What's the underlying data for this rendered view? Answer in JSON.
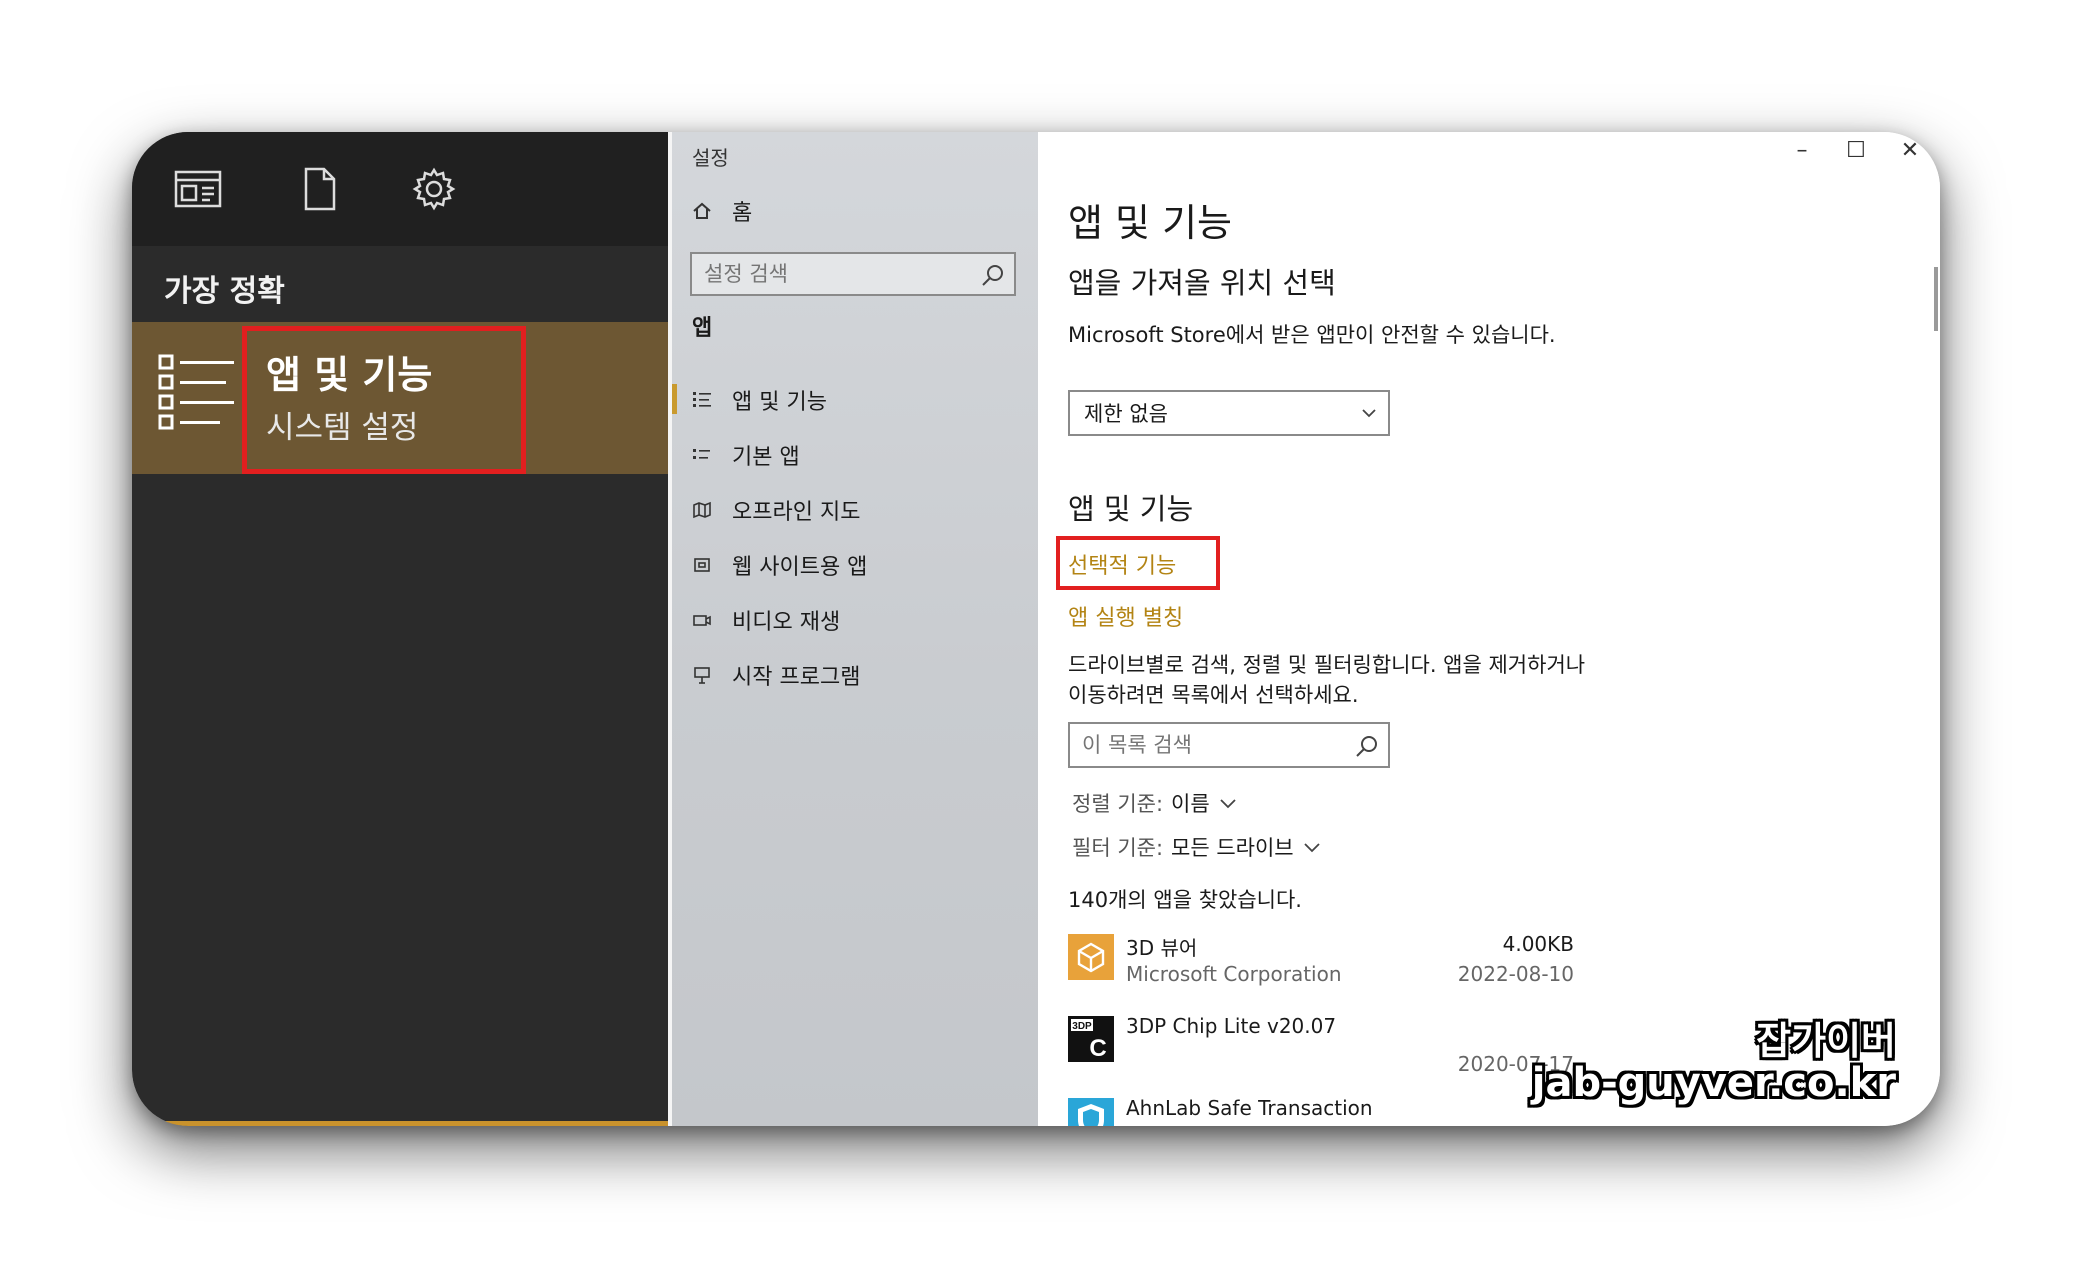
{
  "start_panel": {
    "toolbar_icons": [
      "apps-icon",
      "document-icon",
      "gear-icon"
    ],
    "best_match_label": "가장 정확",
    "result": {
      "title": "앱 및 기능",
      "subtitle": "시스템 설정",
      "icon": "apps-list-icon"
    }
  },
  "settings_window": {
    "title": "설정",
    "controls": {
      "minimize": "–",
      "maximize": "☐",
      "close": "✕"
    }
  },
  "nav": {
    "home_label": "홈",
    "search_placeholder": "설정 검색",
    "section_label": "앱",
    "items": [
      {
        "label": "앱 및 기능",
        "icon": "apps-features-icon",
        "active": true
      },
      {
        "label": "기본 앱",
        "icon": "default-apps-icon",
        "active": false
      },
      {
        "label": "오프라인 지도",
        "icon": "offline-map-icon",
        "active": false
      },
      {
        "label": "웹 사이트용 앱",
        "icon": "apps-for-websites-icon",
        "active": false
      },
      {
        "label": "비디오 재생",
        "icon": "video-playback-icon",
        "active": false
      },
      {
        "label": "시작 프로그램",
        "icon": "startup-icon",
        "active": false
      }
    ]
  },
  "content": {
    "page_title": "앱 및 기능",
    "install_source": {
      "heading": "앱을 가져올 위치 선택",
      "description": "Microsoft Store에서 받은 앱만이 안전할 수 있습니다.",
      "dropdown_value": "제한 없음"
    },
    "apps_section": {
      "heading": "앱 및 기능",
      "optional_features_link": "선택적 기능",
      "app_alias_link": "앱 실행 별칭",
      "description": "드라이브별로 검색, 정렬 및 필터링합니다. 앱을 제거하거나 이동하려면 목록에서 선택하세요.",
      "list_search_placeholder": "이 목록 검색",
      "sort_label": "정렬 기준:",
      "sort_value": "이름",
      "filter_label": "필터 기준:",
      "filter_value": "모든 드라이브",
      "found_text": "140개의 앱을 찾았습니다."
    },
    "apps": [
      {
        "name": "3D 뷰어",
        "publisher": "Microsoft Corporation",
        "size": "4.00KB",
        "date": "2022-08-10",
        "icon": "3d-viewer-icon",
        "color": "#e8a23a"
      },
      {
        "name": "3DP Chip Lite v20.07",
        "publisher": "",
        "size": "",
        "date": "2020-07-17",
        "icon": "3dp-chip-icon",
        "color": "#111111"
      },
      {
        "name": "AhnLab Safe Transaction",
        "publisher": "",
        "size": "",
        "date": "",
        "icon": "ahnlab-shield-icon",
        "color": "#2aa6d8"
      }
    ]
  },
  "watermark": {
    "line1": "잡가이버",
    "line2": "jab-guyver.co.kr"
  },
  "colors": {
    "accent_gold": "#b38414",
    "highlight_red": "#e21f1f",
    "start_result_bg": "#6d5733"
  }
}
